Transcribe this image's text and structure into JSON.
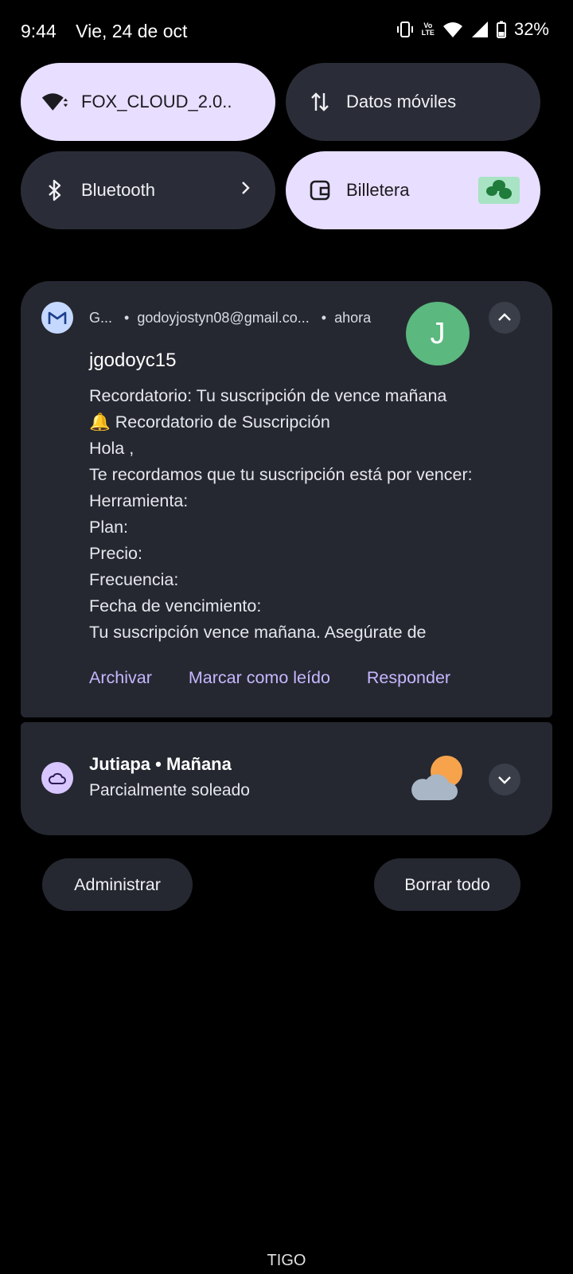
{
  "status_bar": {
    "time": "9:44",
    "date": "Vie, 24 de oct",
    "network_label_top": "Vo",
    "network_label_bottom": "LTE",
    "battery": "32%"
  },
  "quick_settings": {
    "wifi": {
      "label": "FOX_CLOUD_2.0..",
      "icon": "wifi-icon",
      "state": "on"
    },
    "mobile_data": {
      "label": "Datos móviles",
      "icon": "data-arrows-icon",
      "state": "off"
    },
    "bluetooth": {
      "label": "Bluetooth",
      "icon": "bluetooth-icon",
      "state": "off"
    },
    "wallet": {
      "label": "Billetera",
      "icon": "wallet-icon",
      "state": "on"
    }
  },
  "notification": {
    "app_initial": "G...",
    "account": "godoyjostyn08@gmail.co...",
    "time": "ahora",
    "avatar_letter": "J",
    "title": "jgodoyc15",
    "body": [
      "Recordatorio: Tu suscripción de vence mañana",
      "🔔 Recordatorio de Suscripción",
      "Hola ,",
      "Te recordamos que tu suscripción está por vencer:",
      "Herramienta:",
      "Plan:",
      "Precio:",
      "Frecuencia:",
      "Fecha de vencimiento:",
      "Tu suscripción vence mañana. Asegúrate de"
    ],
    "actions": {
      "archive": "Archivar",
      "mark_read": "Marcar como leído",
      "reply": "Responder"
    }
  },
  "weather": {
    "title": "Jutiapa • Mañana",
    "subtitle": "Parcialmente soleado"
  },
  "buttons": {
    "manage": "Administrar",
    "clear_all": "Borrar todo"
  },
  "carrier": "TIGO",
  "colors": {
    "tile_on": "#e8deff",
    "tile_off": "#2a2d37",
    "card_bg": "#252831",
    "action_text": "#c6b7ff",
    "avatar": "#5bb87e"
  }
}
